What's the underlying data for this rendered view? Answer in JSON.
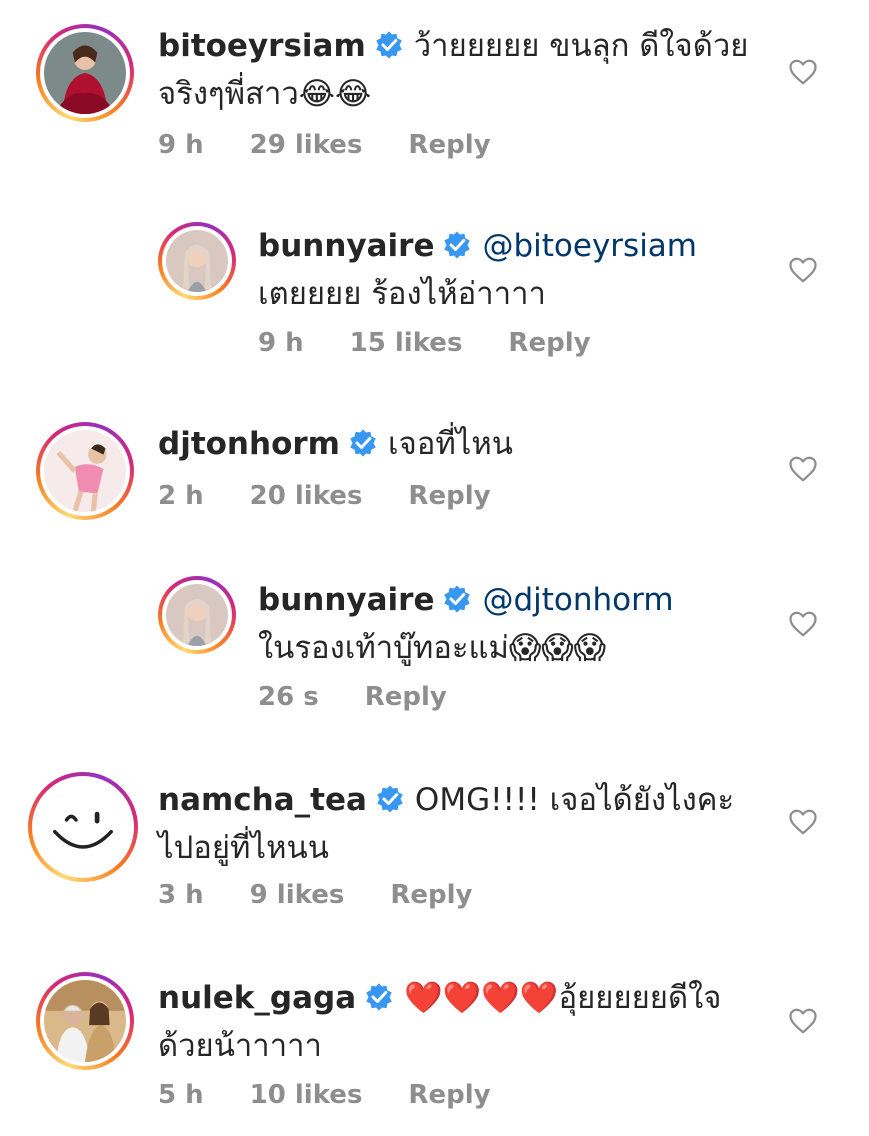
{
  "comments": [
    {
      "username": "bitoeyrsiam",
      "mention": "",
      "text": "ว้ายยยยย ขนลุก ดีใจด้วยจริงๆพี่สาว😂😂",
      "time": "9 h",
      "likes": "29 likes",
      "reply": "Reply",
      "avatar_icon": "profile-photo-red-dress",
      "is_reply": false
    },
    {
      "username": "bunnyaire",
      "mention": "@bitoeyrsiam",
      "text": " เตยยยย ร้องไห้อ่าาาา",
      "time": "9 h",
      "likes": "15 likes",
      "reply": "Reply",
      "avatar_icon": "profile-photo-braids",
      "is_reply": true
    },
    {
      "username": "djtonhorm",
      "mention": "",
      "text": "เจอที่ไหน",
      "time": "2 h",
      "likes": "20 likes",
      "reply": "Reply",
      "avatar_icon": "profile-photo-pink-outfit",
      "is_reply": false
    },
    {
      "username": "bunnyaire",
      "mention": "@djtonhorm",
      "text": " ในรองเท้าบู๊ทอะแม่😱😱😱",
      "time": "26 s",
      "likes": "",
      "reply": "Reply",
      "avatar_icon": "profile-photo-braids",
      "is_reply": true
    },
    {
      "username": "namcha_tea",
      "mention": "",
      "text": "OMG!!!! เจอได้ยังไงคะไปอยู่ที่ไหนน",
      "time": "3 h",
      "likes": "9 likes",
      "reply": "Reply",
      "avatar_icon": "smiley-face-icon",
      "is_reply": false
    },
    {
      "username": "nulek_gaga",
      "mention": "",
      "text": "❤️❤️❤️❤️อุ้ยยยยยดีใจด้วยน้าาาาา",
      "time": "5 h",
      "likes": "10 likes",
      "reply": "Reply",
      "avatar_icon": "profile-photo-two-people",
      "is_reply": false
    }
  ],
  "icons": {
    "verified": "verified-badge-icon",
    "like": "heart-outline-icon"
  },
  "colors": {
    "verified_blue": "#3897f0",
    "mention": "#00376b",
    "meta_gray": "#8e8e8e"
  }
}
